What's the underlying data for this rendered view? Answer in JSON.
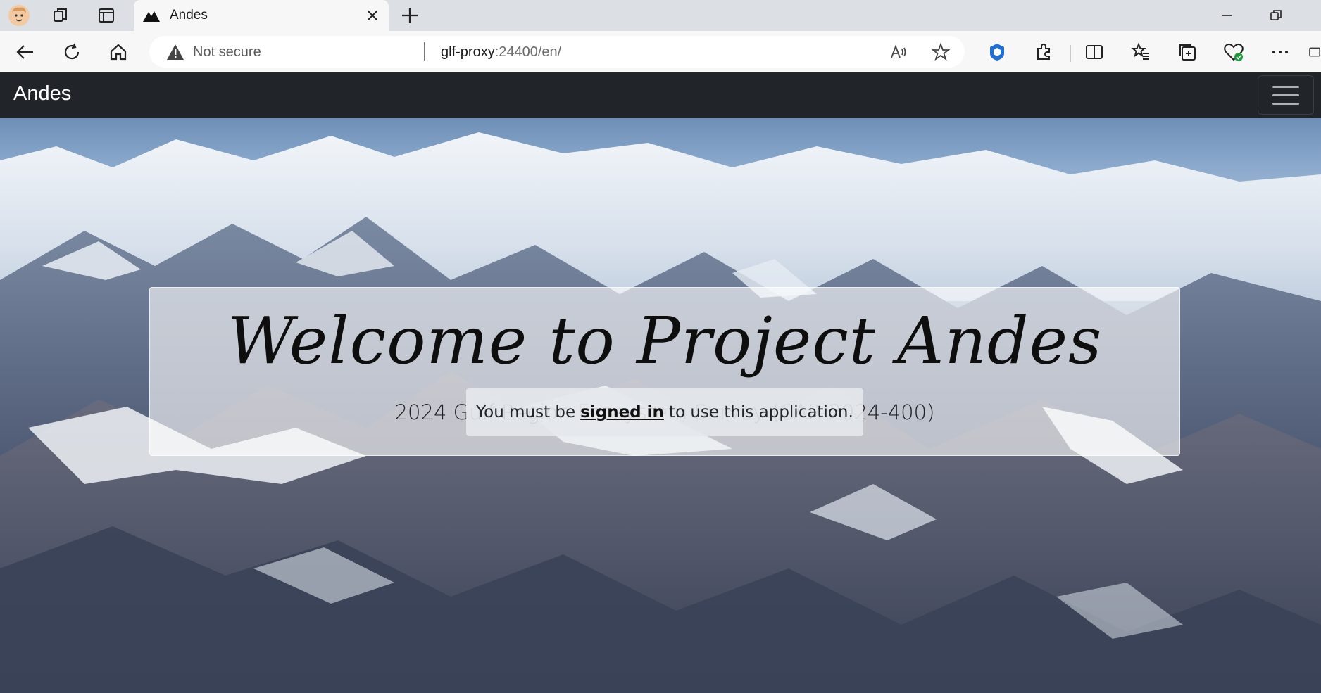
{
  "browser": {
    "tab_title": "Andes",
    "address": {
      "security_label": "Not secure",
      "url_host": "glf-proxy",
      "url_rest": ":24400/en/"
    }
  },
  "navbar": {
    "brand": "Andes"
  },
  "hero": {
    "headline": "Welcome to Project Andes",
    "subtitle": "2024 Gulf Region Ecosystem Survey (CAR-2024-400)",
    "signin": {
      "prefix": "You must be",
      "link": "signed in",
      "suffix": "to use this application."
    }
  }
}
